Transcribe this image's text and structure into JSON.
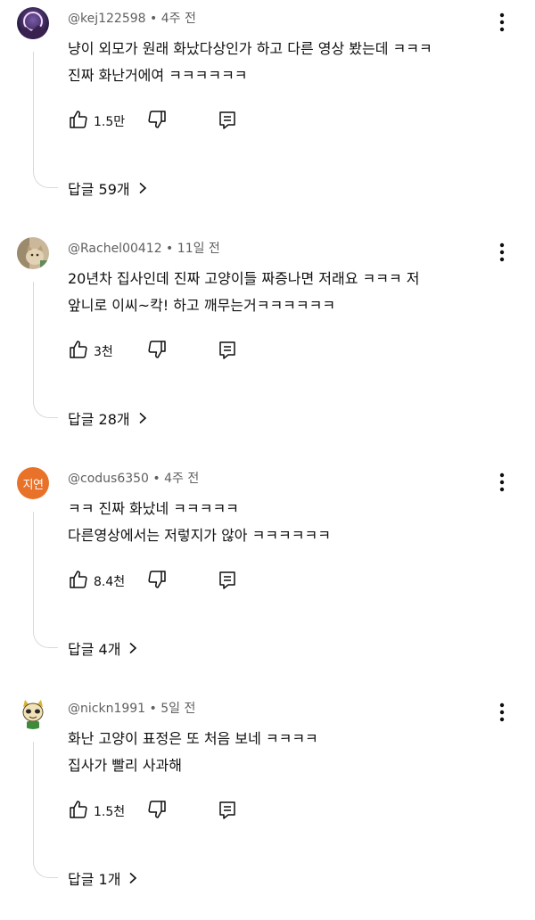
{
  "comments": [
    {
      "author": "@kej122598",
      "time": "4주 전",
      "lines": [
        "냥이 외모가 원래 화났다상인가 하고 다른 영상 봤는데 ㅋㅋㅋ",
        "진짜 화난거에여 ㅋㅋㅋㅋㅋㅋ"
      ],
      "likes": "1.5만",
      "replies": "답글 59개",
      "avatar": "moon-night-avatar"
    },
    {
      "author": "@Rachel00412",
      "time": "11일 전",
      "lines": [
        "20년차 집사인데 진짜 고양이들 짜증나면 저래요 ㅋㅋㅋ 저",
        "앞니로 이씨~칵! 하고 깨무는거ㅋㅋㅋㅋㅋㅋ"
      ],
      "likes": "3천",
      "replies": "답글 28개",
      "avatar": "cat-photo-avatar"
    },
    {
      "author": "@codus6350",
      "time": "4주 전",
      "lines": [
        "ㅋㅋ 진짜 화났네 ㅋㅋㅋㅋㅋ",
        "다른영상에서는 저렇지가 않아 ㅋㅋㅋㅋㅋㅋ"
      ],
      "likes": "8.4천",
      "replies": "답글 4개",
      "avatar_text": "지연",
      "avatar": "initials-avatar"
    },
    {
      "author": "@nickn1991",
      "time": "5일 전",
      "lines": [
        "화난 고양이 표정은 또 처음 보네 ㅋㅋㅋㅋ",
        "집사가 빨리 사과해"
      ],
      "likes": "1.5천",
      "replies": "답글 1개",
      "avatar": "cartoon-character-avatar"
    }
  ],
  "separator": " • ",
  "icons": {
    "like": "thumbs-up-icon",
    "dislike": "thumbs-down-icon",
    "reply": "comment-reply-icon",
    "more": "more-vertical-icon",
    "expand": "chevron-right-icon"
  },
  "colors": {
    "text": "#0f0f0f",
    "meta": "#606060",
    "thread_line": "#d9d9d9",
    "avatar_orange": "#e8722a"
  }
}
